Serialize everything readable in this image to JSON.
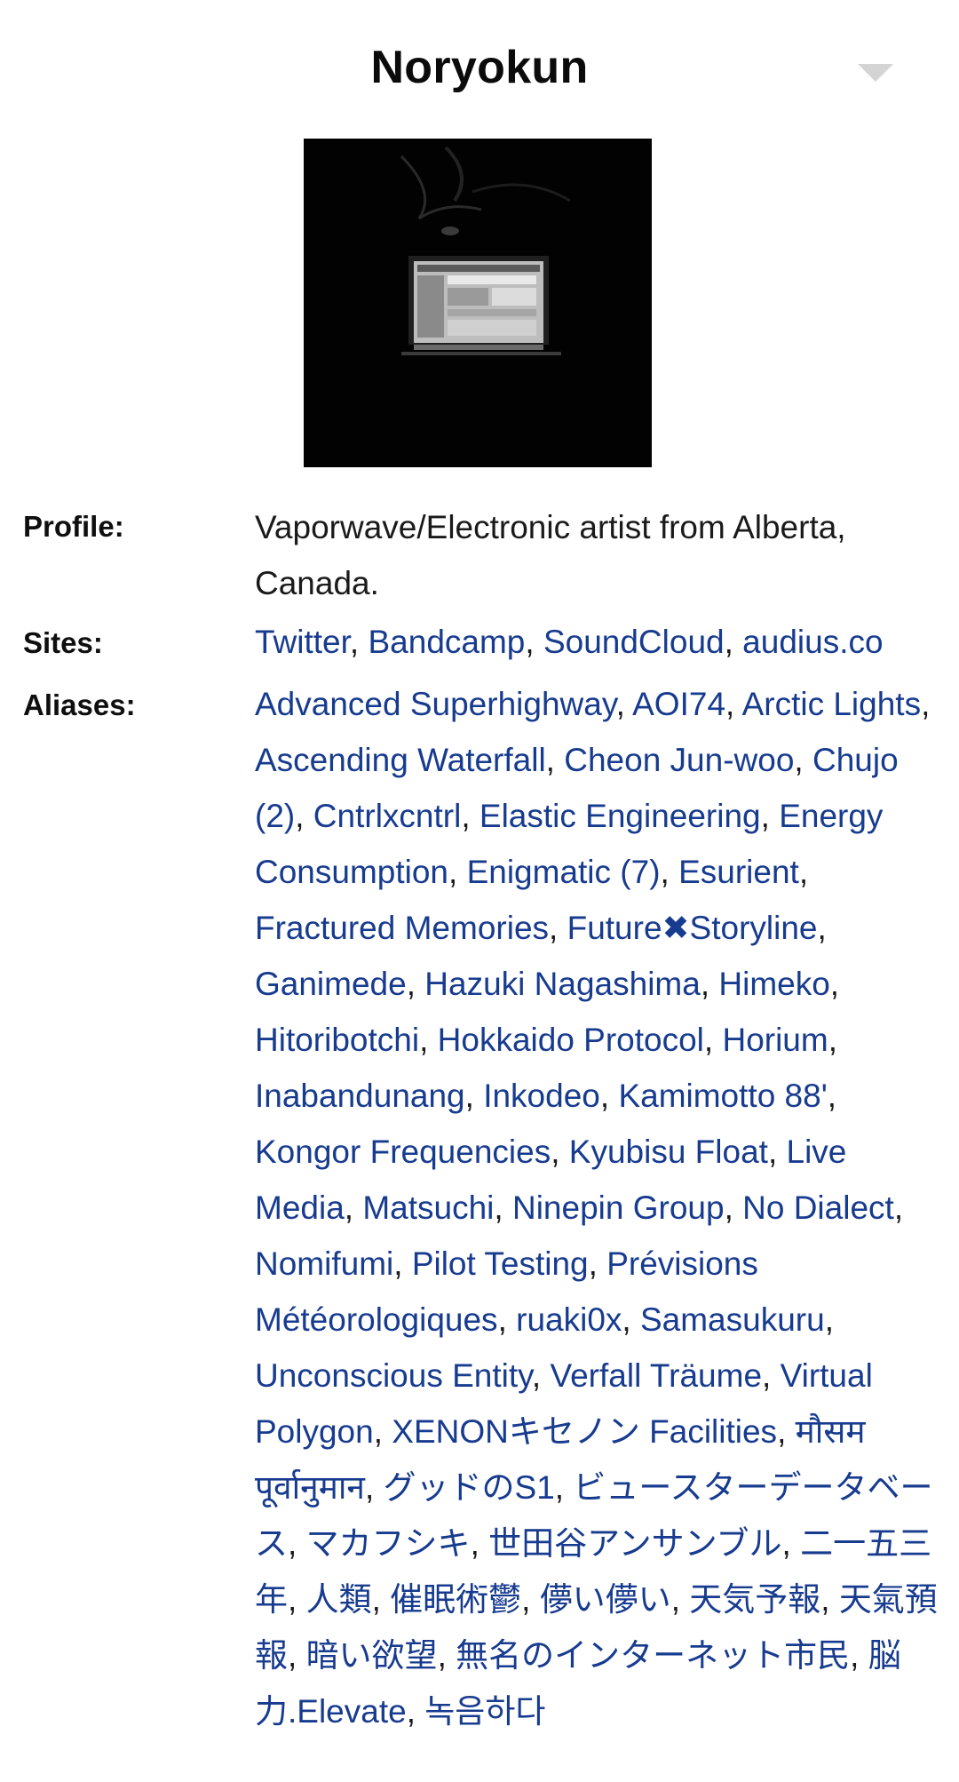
{
  "header": {
    "title": "Noryokun"
  },
  "profile": {
    "label": "Profile:",
    "text": "Vaporwave/Electronic artist from Alberta, Canada."
  },
  "sites": {
    "label": "Sites:",
    "items": [
      "Twitter",
      "Bandcamp",
      "SoundCloud",
      "audius.co"
    ]
  },
  "aliases": {
    "label": "Aliases:",
    "items": [
      "Advanced Superhighway",
      "AOI74",
      "Arctic Lights",
      "Ascending Waterfall",
      "Cheon Jun-woo",
      "Chujo (2)",
      "Cntrlxcntrl",
      "Elastic Engineering",
      "Energy Consumption",
      "Enigmatic (7)",
      "Esurient",
      "Fractured Memories",
      "Future✖Storyline",
      "Ganimede",
      "Hazuki Nagashima",
      "Himeko",
      "Hitoribotchi",
      "Hokkaido Protocol",
      "Horium",
      "Inabandunang",
      "Inkodeo",
      "Kamimotto 88'",
      "Kongor Frequencies",
      "Kyubisu Float",
      "Live Media",
      "Matsuchi",
      "Ninepin Group",
      "No Dialect",
      "Nomifumi",
      "Pilot Testing",
      "Prévisions Météorologiques",
      "ruaki0x",
      "Samasukuru",
      "Unconscious Entity",
      "Verfall Träume",
      "Virtual Polygon",
      "XENONキセノン Facilities",
      "मौसम पूर्वानुमान",
      "グッドのS1",
      "ビュースターデータベース",
      "マカフシキ",
      "世田谷アンサンブル",
      "二一五三年",
      "人類",
      "催眠術鬱",
      "儚い儚い",
      "天気予報",
      "天氣預報",
      "暗い欲望",
      "無名のインターネット市民",
      "脳力.Elevate",
      "녹음하다"
    ]
  },
  "colors": {
    "link": "#173b8f",
    "text": "#1a1a1a",
    "caret": "#d4d4d4"
  },
  "icons": {
    "dropdown": "chevron-down-icon"
  }
}
